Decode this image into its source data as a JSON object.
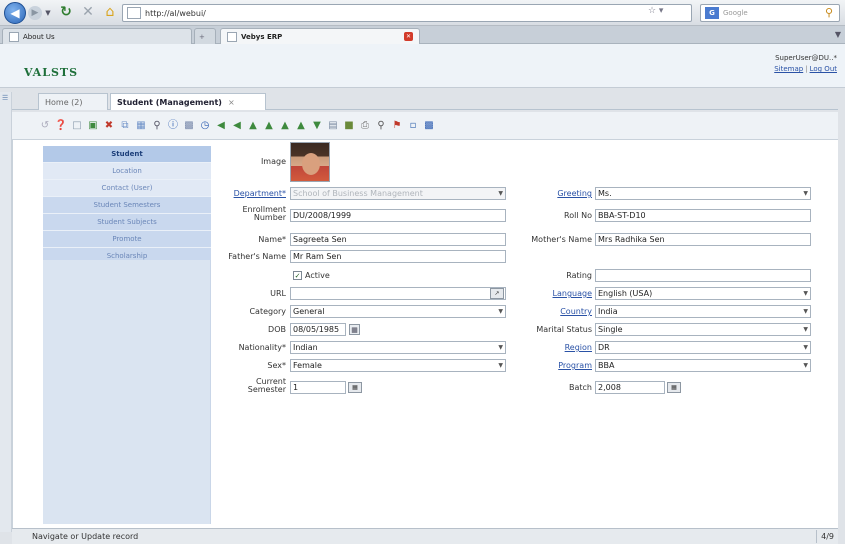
{
  "browser": {
    "url": "http://al/webui/",
    "search_placeholder": "Google",
    "tabs": [
      {
        "label": "About Us"
      },
      {
        "label": "Vebys ERP"
      }
    ]
  },
  "app": {
    "logo": "VALSTS",
    "user": "SuperUser@DU..*",
    "links": {
      "sitemap": "Sitemap",
      "logout": "Log Out"
    }
  },
  "page_tabs": [
    {
      "label": "Home (2)"
    },
    {
      "label": "Student (Management)",
      "close": "×"
    }
  ],
  "sidebar": {
    "items": [
      {
        "label": "Student"
      },
      {
        "label": "Location"
      },
      {
        "label": "Contact (User)"
      },
      {
        "label": "Student Semesters"
      },
      {
        "label": "Student Subjects"
      },
      {
        "label": "Promote"
      },
      {
        "label": "Scholarship"
      }
    ]
  },
  "form": {
    "image_label": "Image",
    "department": {
      "label": "Department*",
      "value": "School of Business Management"
    },
    "greeting": {
      "label": "Greeting",
      "value": "Ms."
    },
    "enrollment": {
      "label": "Enrollment Number",
      "value": "DU/2008/1999"
    },
    "rollno": {
      "label": "Roll No",
      "value": "BBA-ST-D10"
    },
    "name": {
      "label": "Name*",
      "value": "Sagreeta Sen"
    },
    "mothers_name": {
      "label": "Mother's Name",
      "value": "Mrs Radhika Sen"
    },
    "fathers_name": {
      "label": "Father's Name",
      "value": "Mr Ram Sen"
    },
    "active": {
      "label": "Active",
      "checked": true
    },
    "rating": {
      "label": "Rating",
      "value": ""
    },
    "url": {
      "label": "URL",
      "value": ""
    },
    "language": {
      "label": "Language",
      "value": "English (USA)"
    },
    "category": {
      "label": "Category",
      "value": "General"
    },
    "country": {
      "label": "Country",
      "value": "India"
    },
    "dob": {
      "label": "DOB",
      "value": "08/05/1985"
    },
    "marital_status": {
      "label": "Marital Status",
      "value": "Single"
    },
    "nationality": {
      "label": "Nationality*",
      "value": "Indian"
    },
    "region": {
      "label": "Region",
      "value": "DR"
    },
    "sex": {
      "label": "Sex*",
      "value": "Female"
    },
    "program": {
      "label": "Program",
      "value": "BBA"
    },
    "current_semester": {
      "label": "Current Semester",
      "value": "1"
    },
    "batch": {
      "label": "Batch",
      "value": "2,008"
    }
  },
  "status": {
    "text": "Navigate or Update record",
    "pager": "4/9"
  },
  "colors": {
    "accent": "#2a52a6",
    "sidebar_active": "#b3c9e8",
    "logo": "#1e6f3a"
  }
}
